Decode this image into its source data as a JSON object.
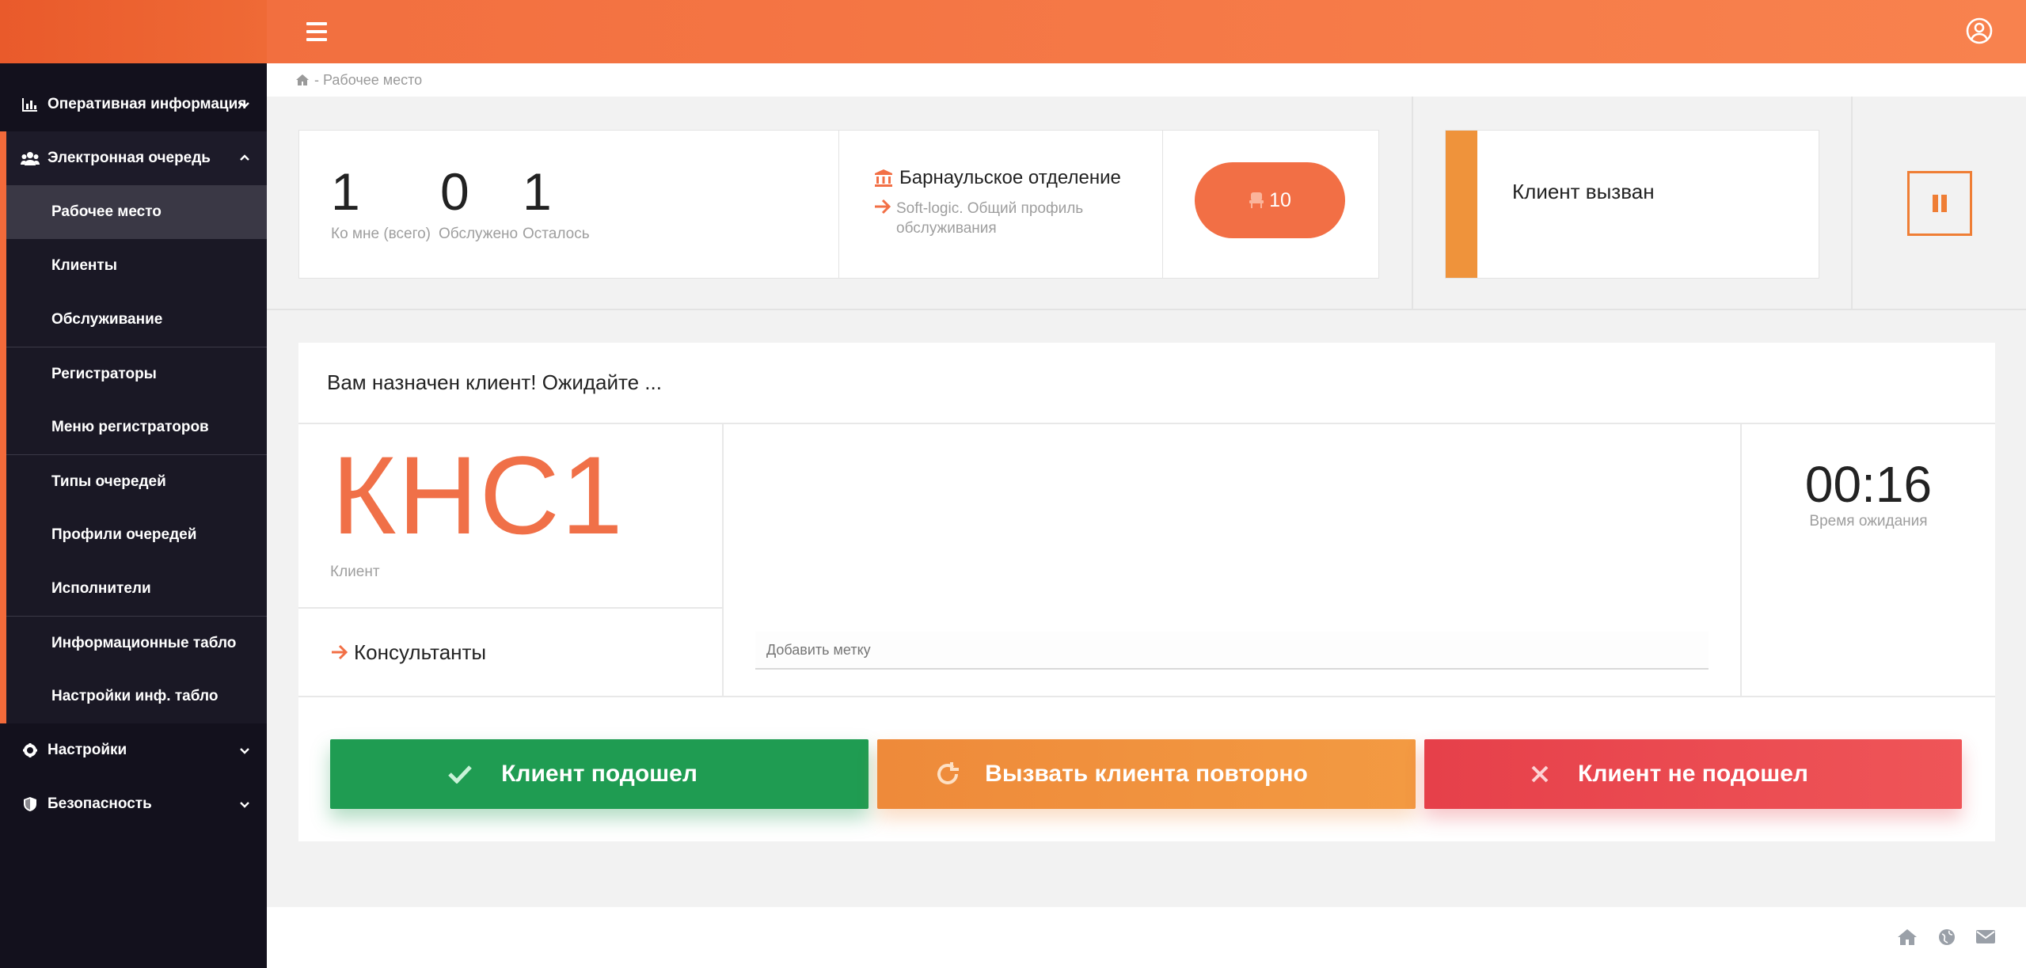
{
  "sidebar": {
    "items": [
      {
        "label": "Оперативная информация",
        "icon": "chart-icon"
      },
      {
        "label": "Электронная очередь",
        "icon": "users-icon"
      },
      {
        "label": "Настройки",
        "icon": "gear-icon"
      },
      {
        "label": "Безопасность",
        "icon": "shield-icon"
      }
    ],
    "subitems": [
      {
        "label": "Рабочее место"
      },
      {
        "label": "Клиенты"
      },
      {
        "label": "Обслуживание"
      },
      {
        "label": "Регистраторы"
      },
      {
        "label": "Меню регистраторов"
      },
      {
        "label": "Типы очередей"
      },
      {
        "label": "Профили очередей"
      },
      {
        "label": "Исполнители"
      },
      {
        "label": "Информационные табло"
      },
      {
        "label": "Настройки инф. табло"
      }
    ]
  },
  "breadcrumb": {
    "current": "- Рабочее место"
  },
  "stats": [
    {
      "value": "1",
      "label": "Ко мне (всего)"
    },
    {
      "value": "0",
      "label": "Обслужено"
    },
    {
      "value": "1",
      "label": "Осталось"
    }
  ],
  "branch": {
    "title": "Барнаульское отделение",
    "profile": "Soft-logic. Общий профиль обслуживания"
  },
  "workplace": {
    "number": "10"
  },
  "status": {
    "text": "Клиент вызван"
  },
  "main": {
    "header": "Вам назначен клиент! Ожидайте ...",
    "ticket": "КНС1",
    "ticket_label": "Клиент",
    "consultants": "Консультанты",
    "tag_placeholder": "Добавить метку",
    "timer": "00:16",
    "timer_label": "Время ожидания"
  },
  "actions": {
    "ok": "Клиент подошел",
    "retry": "Вызвать клиента повторно",
    "no": "Клиент не подошел"
  },
  "colors": {
    "accent": "#f26f3f",
    "sidebar": "#13111d",
    "success": "#1f9c52",
    "warning": "#ef933b",
    "danger": "#e6404a"
  }
}
